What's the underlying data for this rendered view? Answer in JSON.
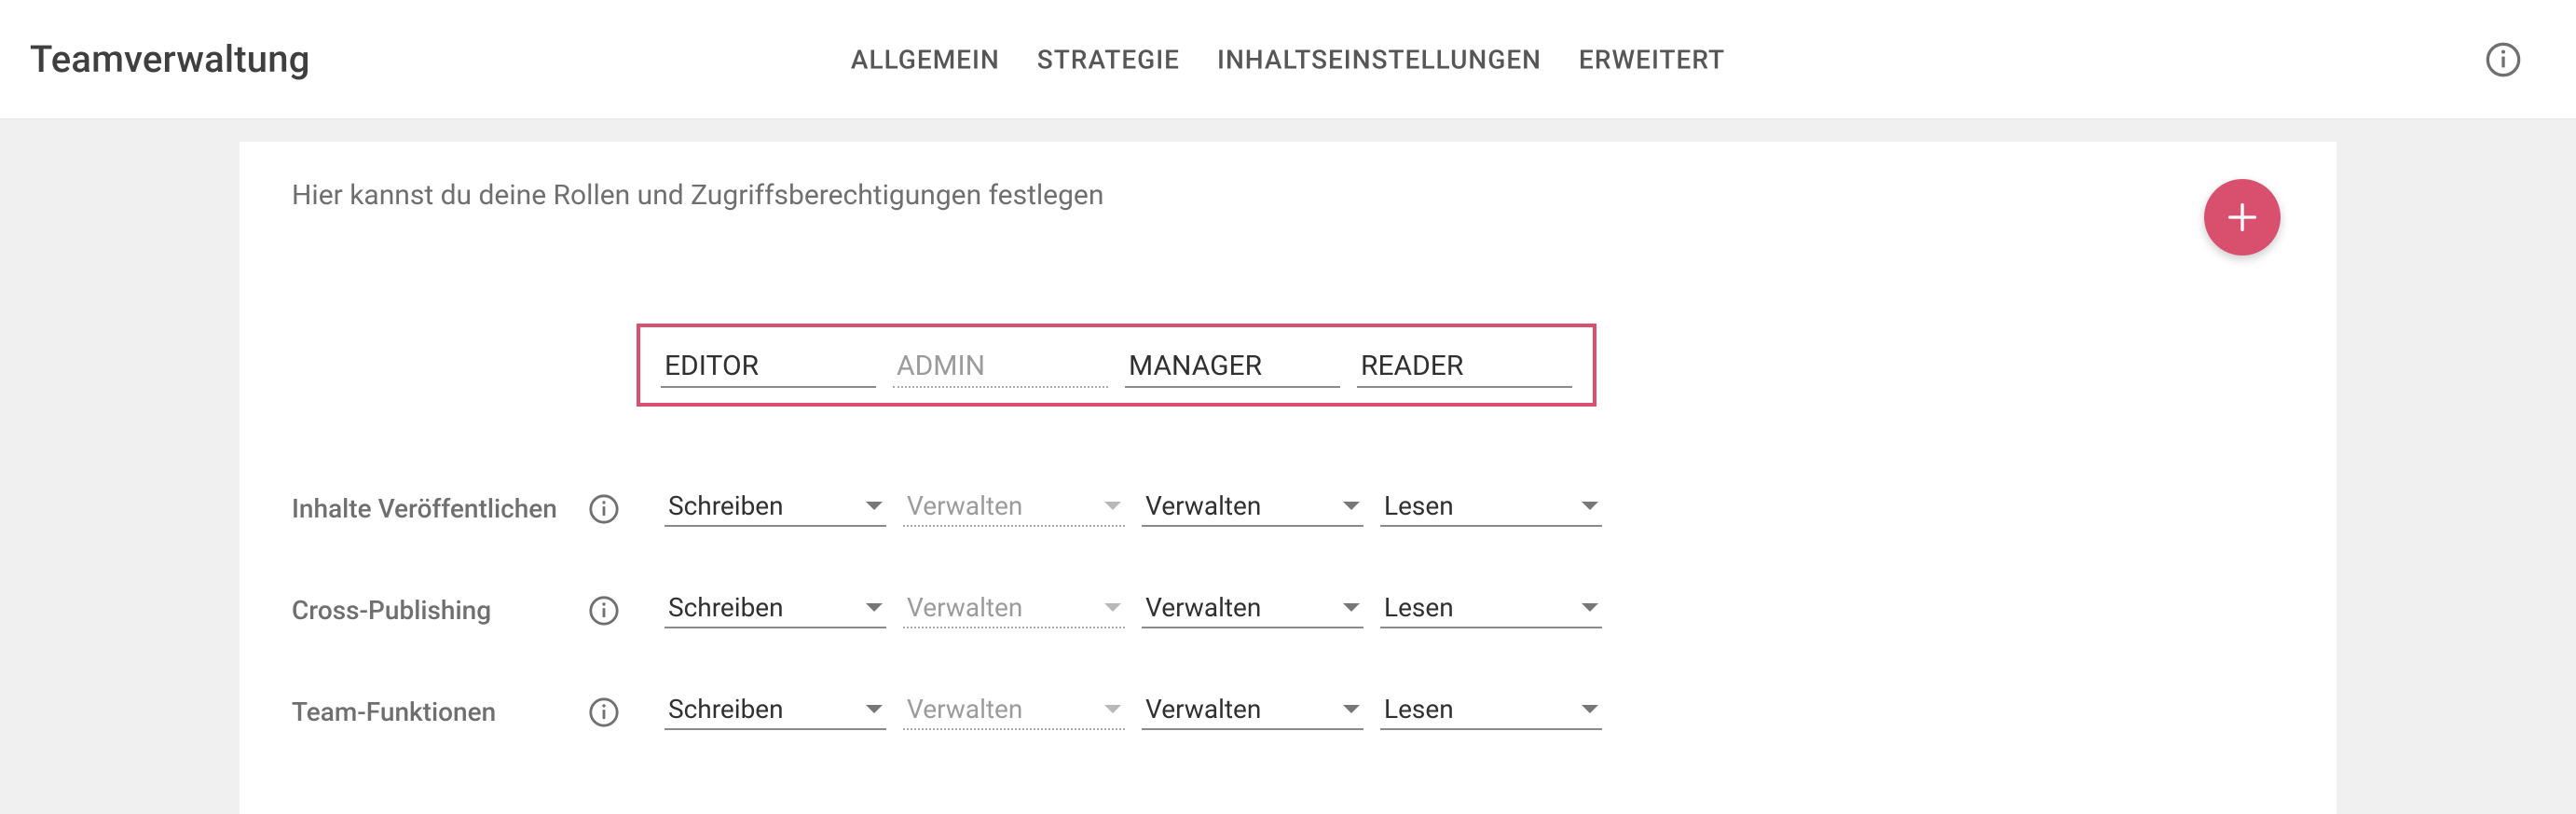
{
  "header": {
    "title": "Teamverwaltung",
    "tabs": [
      "ALLGEMEIN",
      "STRATEGIE",
      "INHALTSEINSTELLUNGEN",
      "ERWEITERT"
    ]
  },
  "card": {
    "description": "Hier kannst du deine Rollen und Zugriffsberechtigungen festlegen"
  },
  "roles": [
    {
      "name": "EDITOR",
      "disabled": false
    },
    {
      "name": "ADMIN",
      "disabled": true
    },
    {
      "name": "MANAGER",
      "disabled": false
    },
    {
      "name": "READER",
      "disabled": false
    }
  ],
  "permissions": [
    {
      "label": "Inhalte Veröffentlichen",
      "values": [
        {
          "value": "Schreiben",
          "disabled": false
        },
        {
          "value": "Verwalten",
          "disabled": true
        },
        {
          "value": "Verwalten",
          "disabled": false
        },
        {
          "value": "Lesen",
          "disabled": false
        }
      ]
    },
    {
      "label": "Cross-Publishing",
      "values": [
        {
          "value": "Schreiben",
          "disabled": false
        },
        {
          "value": "Verwalten",
          "disabled": true
        },
        {
          "value": "Verwalten",
          "disabled": false
        },
        {
          "value": "Lesen",
          "disabled": false
        }
      ]
    },
    {
      "label": "Team-Funktionen",
      "values": [
        {
          "value": "Schreiben",
          "disabled": false
        },
        {
          "value": "Verwalten",
          "disabled": true
        },
        {
          "value": "Verwalten",
          "disabled": false
        },
        {
          "value": "Lesen",
          "disabled": false
        }
      ]
    }
  ],
  "colors": {
    "accent": "#d94f6e"
  }
}
